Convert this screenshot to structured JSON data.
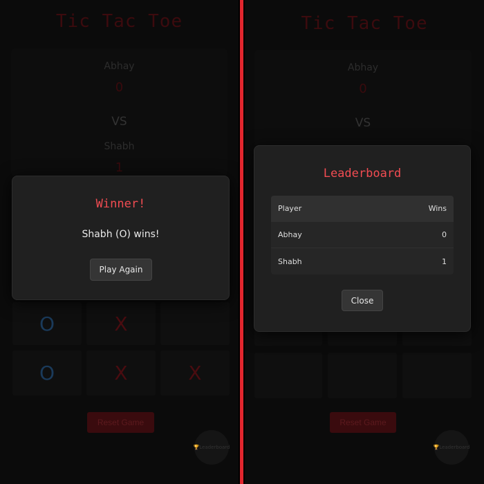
{
  "app_title": "Tic Tac Toe",
  "players": {
    "p1": {
      "name": "Abhay",
      "score": "0"
    },
    "vs": "VS",
    "p2": {
      "name": "Shabh",
      "score": "1"
    }
  },
  "board": [
    {
      "mark": "O",
      "type": "o"
    },
    {
      "mark": "X",
      "type": "x"
    },
    {
      "mark": "",
      "type": "empty"
    },
    {
      "mark": "O",
      "type": "o"
    },
    {
      "mark": "X",
      "type": "x"
    },
    {
      "mark": "X",
      "type": "x"
    }
  ],
  "reset_label": "Reset Game",
  "leaderboard_fab_label": "Leaderboard",
  "winner_modal": {
    "title": "Winner!",
    "message": "Shabh (O) wins!",
    "button": "Play Again"
  },
  "leaderboard_modal": {
    "title": "Leaderboard",
    "columns": [
      "Player",
      "Wins"
    ],
    "rows": [
      {
        "player": "Abhay",
        "wins": "0"
      },
      {
        "player": "Shabh",
        "wins": "1"
      }
    ],
    "button": "Close"
  },
  "colors": {
    "accent": "#e3262e",
    "title_red": "#f24c52",
    "o_blue": "#1a3a5a",
    "x_red": "#4a0c10"
  }
}
